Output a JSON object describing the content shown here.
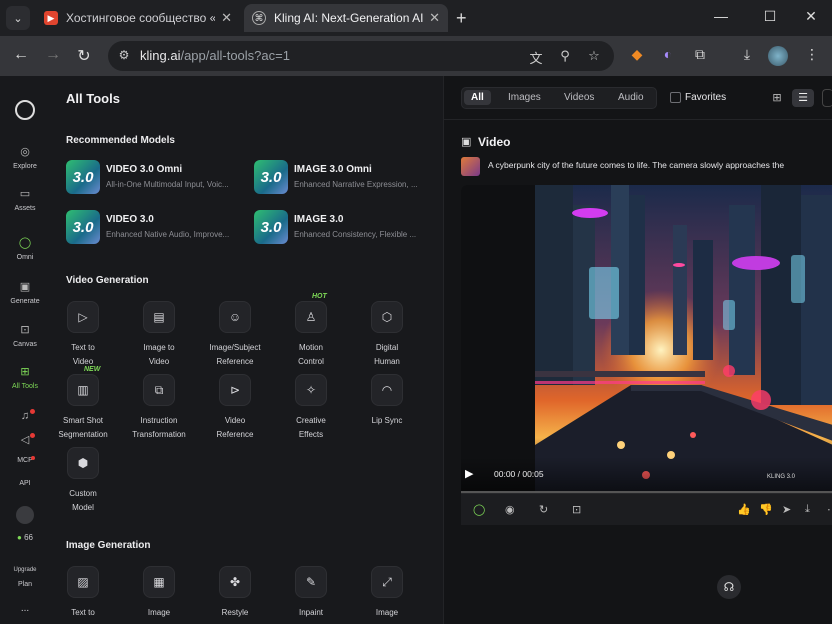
{
  "browser": {
    "tabs": [
      {
        "title": "Хостинговое сообщество «Tim",
        "active": false
      },
      {
        "title": "Kling AI: Next-Generation AI Cr",
        "active": true
      }
    ],
    "url_host": "kling.ai",
    "url_path": "/app/all-tools?ac=1"
  },
  "sidebar": {
    "items": [
      {
        "label": "Explore"
      },
      {
        "label": "Assets"
      },
      {
        "label": "Omni"
      },
      {
        "label": "Generate"
      },
      {
        "label": "Canvas"
      },
      {
        "label": "All Tools"
      },
      {
        "label": "MCP"
      },
      {
        "label": "API"
      }
    ],
    "credits": "66",
    "upgrade_label": "Upgrade",
    "plan_label": "Plan",
    "more_label": "..."
  },
  "tools": {
    "title": "All Tools",
    "recommended_heading": "Recommended Models",
    "models": [
      {
        "name": "VIDEO 3.0 Omni",
        "desc": "All-in-One Multimodal Input, Voic...",
        "thumb": "3.0"
      },
      {
        "name": "IMAGE 3.0 Omni",
        "desc": "Enhanced Narrative Expression, ...",
        "thumb": "3.0"
      },
      {
        "name": "VIDEO 3.0",
        "desc": "Enhanced Native Audio, Improve...",
        "thumb": "3.0"
      },
      {
        "name": "IMAGE 3.0",
        "desc": "Enhanced Consistency, Flexible ...",
        "thumb": "3.0"
      }
    ],
    "video_heading": "Video Generation",
    "video_tools": [
      {
        "line1": "Text to",
        "line2": "Video",
        "badge": ""
      },
      {
        "line1": "Image to",
        "line2": "Video",
        "badge": ""
      },
      {
        "line1": "Image/Subject",
        "line2": "Reference",
        "badge": ""
      },
      {
        "line1": "Motion",
        "line2": "Control",
        "badge": "HOT"
      },
      {
        "line1": "Digital",
        "line2": "Human",
        "badge": ""
      },
      {
        "line1": "Smart Shot",
        "line2": "Segmentation",
        "badge": "NEW"
      },
      {
        "line1": "Instruction",
        "line2": "Transformation",
        "badge": ""
      },
      {
        "line1": "Video",
        "line2": "Reference",
        "badge": ""
      },
      {
        "line1": "Creative",
        "line2": "Effects",
        "badge": ""
      },
      {
        "line1": "Lip Sync",
        "line2": "",
        "badge": ""
      },
      {
        "line1": "Custom",
        "line2": "Model",
        "badge": ""
      }
    ],
    "image_heading": "Image Generation",
    "image_tools": [
      {
        "line1": "Text to"
      },
      {
        "line1": "Image"
      },
      {
        "line1": "Restyle"
      },
      {
        "line1": "Inpaint"
      },
      {
        "line1": "Image"
      }
    ]
  },
  "viewer": {
    "filters": [
      "All",
      "Images",
      "Videos",
      "Audio"
    ],
    "favorites_label": "Favorites",
    "section_title": "Video",
    "prompt": "A cyberpunk city of the future comes to life. The camera slowly approaches the",
    "time": "00:00 / 00:05",
    "watermark": "KLING 3.0"
  },
  "colors": {
    "accent": "#7ed957",
    "background": "#131416",
    "panel": "#18191c"
  }
}
